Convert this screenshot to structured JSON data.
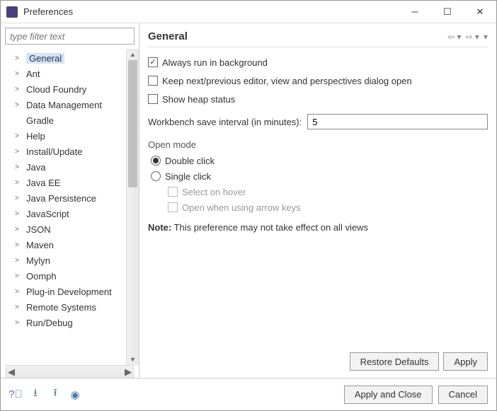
{
  "window": {
    "title": "Preferences"
  },
  "filter": {
    "placeholder": "type filter text"
  },
  "tree": {
    "items": [
      {
        "label": "General",
        "selected": true,
        "expandable": true
      },
      {
        "label": "Ant",
        "expandable": true
      },
      {
        "label": "Cloud Foundry",
        "expandable": true
      },
      {
        "label": "Data Management",
        "expandable": true
      },
      {
        "label": "Gradle",
        "expandable": false
      },
      {
        "label": "Help",
        "expandable": true
      },
      {
        "label": "Install/Update",
        "expandable": true
      },
      {
        "label": "Java",
        "expandable": true
      },
      {
        "label": "Java EE",
        "expandable": true
      },
      {
        "label": "Java Persistence",
        "expandable": true
      },
      {
        "label": "JavaScript",
        "expandable": true
      },
      {
        "label": "JSON",
        "expandable": true
      },
      {
        "label": "Maven",
        "expandable": true
      },
      {
        "label": "Mylyn",
        "expandable": true
      },
      {
        "label": "Oomph",
        "expandable": true
      },
      {
        "label": "Plug-in Development",
        "expandable": true
      },
      {
        "label": "Remote Systems",
        "expandable": true
      },
      {
        "label": "Run/Debug",
        "expandable": true
      }
    ]
  },
  "page": {
    "heading": "General",
    "checkboxes": {
      "always_bg": {
        "label": "Always run in background",
        "checked": true
      },
      "keep_next": {
        "label": "Keep next/previous editor, view and perspectives dialog open",
        "checked": false
      },
      "heap": {
        "label": "Show heap status",
        "checked": false
      }
    },
    "save_interval": {
      "label": "Workbench save interval (in minutes):",
      "value": "5"
    },
    "open_mode": {
      "title": "Open mode",
      "double": "Double click",
      "single": "Single click",
      "selected": "double",
      "hover": "Select on hover",
      "arrow": "Open when using arrow keys"
    },
    "note_label": "Note:",
    "note_text": "This preference may not take effect on all views"
  },
  "buttons": {
    "restore": "Restore Defaults",
    "apply": "Apply",
    "apply_close": "Apply and Close",
    "cancel": "Cancel"
  }
}
